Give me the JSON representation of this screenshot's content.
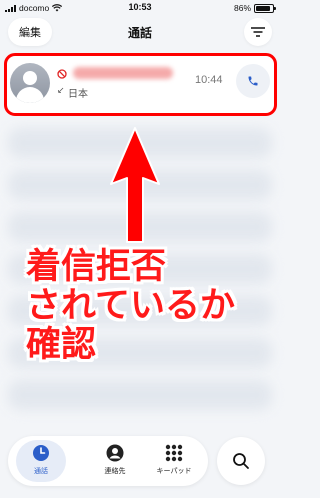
{
  "status_bar": {
    "carrier": "docomo",
    "time": "10:53",
    "battery": "86%",
    "battery_level": 0.86
  },
  "header": {
    "edit_label": "編集",
    "title": "通話",
    "filter_icon": "filter-lines-icon"
  },
  "call_entry": {
    "status_icon": "blocked-icon",
    "direction_icon": "incoming-arrow-icon",
    "location": "日本",
    "time": "10:44",
    "call_icon": "phone-icon"
  },
  "annotation": {
    "lines": [
      "着信拒否",
      "されているか",
      "確認"
    ],
    "color": "#ff1a1a"
  },
  "tabs": [
    {
      "label": "通話",
      "icon": "clock-icon",
      "active": true
    },
    {
      "label": "連絡先",
      "icon": "person-icon",
      "active": false
    },
    {
      "label": "キーパッド",
      "icon": "keypad-icon",
      "active": false
    }
  ],
  "search_icon": "search-icon",
  "colors": {
    "accent": "#2b5ec9",
    "highlight": "#ff0000",
    "arrow": "#ff0000"
  }
}
